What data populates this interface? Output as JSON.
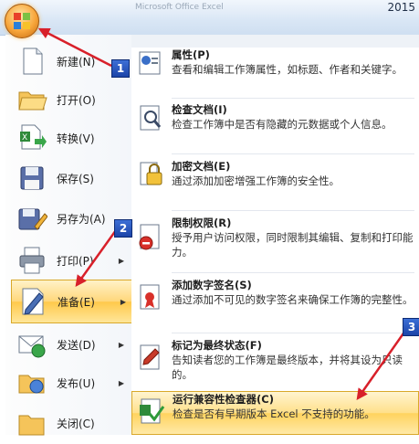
{
  "titlebar": {
    "title": "Microsoft Office Excel",
    "year": "2015"
  },
  "left_menu": [
    {
      "label": "新建(N)",
      "icon": "new-document-icon"
    },
    {
      "label": "打开(O)",
      "icon": "open-folder-icon"
    },
    {
      "label": "转换(V)",
      "icon": "convert-icon"
    },
    {
      "label": "保存(S)",
      "icon": "save-disk-icon"
    },
    {
      "label": "另存为(A)",
      "icon": "save-as-icon"
    },
    {
      "label": "打印(P)",
      "icon": "printer-icon"
    },
    {
      "label": "准备(E)",
      "icon": "prepare-icon",
      "selected": true
    },
    {
      "label": "发送(D)",
      "icon": "send-icon"
    },
    {
      "label": "发布(U)",
      "icon": "publish-icon"
    },
    {
      "label": "关闭(C)",
      "icon": "close-folder-icon"
    }
  ],
  "submenu": [
    {
      "title": "属性(P)",
      "desc": "查看和编辑工作簿属性，如标题、作者和关键字。",
      "icon": "properties-icon"
    },
    {
      "title": "检查文档(I)",
      "desc": "检查工作簿中是否有隐藏的元数据或个人信息。",
      "icon": "inspect-document-icon"
    },
    {
      "title": "加密文档(E)",
      "desc": "通过添加加密增强工作簿的安全性。",
      "icon": "encrypt-lock-icon"
    },
    {
      "title": "限制权限(R)",
      "desc": "授予用户访问权限，同时限制其编辑、复制和打印能力。",
      "icon": "restrict-permission-icon"
    },
    {
      "title": "添加数字签名(S)",
      "desc": "通过添加不可见的数字签名来确保工作簿的完整性。",
      "icon": "digital-signature-icon"
    },
    {
      "title": "标记为最终状态(F)",
      "desc": "告知读者您的工作簿是最终版本，并将其设为只读的。",
      "icon": "mark-final-icon"
    },
    {
      "title": "运行兼容性检查器(C)",
      "desc": "检查是否有早期版本 Excel 不支持的功能。",
      "icon": "compatibility-checker-icon",
      "highlighted": true
    }
  ],
  "callouts": [
    "1",
    "2",
    "3"
  ],
  "colors": {
    "annotation_red": "#d8202a",
    "callout_blue": "#2553c0",
    "highlight_gold": "#ffd35e"
  }
}
